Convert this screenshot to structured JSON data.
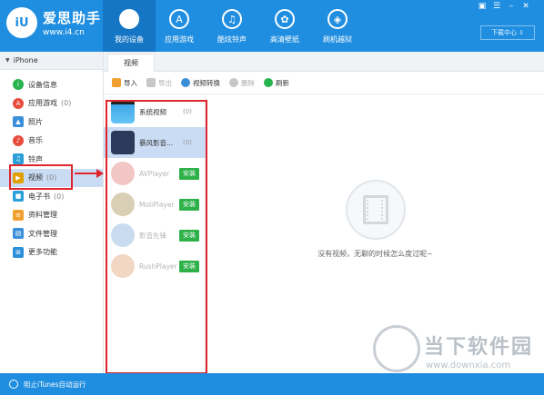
{
  "app": {
    "brand": "爱思助手",
    "url": "www.i4.cn",
    "logo": "iU"
  },
  "nav": [
    {
      "label": "我的设备",
      "icon": "apple-icon",
      "glyph": ""
    },
    {
      "label": "应用游戏",
      "icon": "app-store-icon",
      "glyph": "A"
    },
    {
      "label": "酷炫铃声",
      "icon": "music-note-icon",
      "glyph": "♫"
    },
    {
      "label": "高清壁纸",
      "icon": "flower-icon",
      "glyph": "✿"
    },
    {
      "label": "刷机越狱",
      "icon": "dropbox-icon",
      "glyph": "◈"
    }
  ],
  "window": {
    "download_center": "下载中心 ⇩"
  },
  "sidebar": {
    "device": "iPhone",
    "items": [
      {
        "label": "设备信息",
        "icon": "info-icon",
        "color": "#27b34d",
        "glyph": "i",
        "count": ""
      },
      {
        "label": "应用游戏",
        "icon": "apps-icon",
        "color": "#e74c3c",
        "glyph": "A",
        "count": "(0)"
      },
      {
        "label": "照片",
        "icon": "photo-icon",
        "color": "#3a8fd8",
        "glyph": "▲",
        "count": ""
      },
      {
        "label": "音乐",
        "icon": "music-icon",
        "color": "#e74c3c",
        "glyph": "♪",
        "count": ""
      },
      {
        "label": "铃声",
        "icon": "bell-icon",
        "color": "#2a9fd8",
        "glyph": "♫",
        "count": ""
      },
      {
        "label": "视频",
        "icon": "video-icon",
        "color": "#e0a100",
        "glyph": "▶",
        "count": "(0)"
      },
      {
        "label": "电子书",
        "icon": "ebook-icon",
        "color": "#2a9fd8",
        "glyph": "■",
        "count": "(0)"
      },
      {
        "label": "资料管理",
        "icon": "data-icon",
        "color": "#f0a030",
        "glyph": "≡",
        "count": ""
      },
      {
        "label": "文件管理",
        "icon": "file-icon",
        "color": "#3a8fd8",
        "glyph": "▤",
        "count": ""
      },
      {
        "label": "更多功能",
        "icon": "more-icon",
        "color": "#2a8fd8",
        "glyph": "⊞",
        "count": ""
      }
    ]
  },
  "content": {
    "tab": "视频",
    "toolbar": [
      {
        "label": "导入",
        "icon": "import-icon",
        "color": "#f0a030",
        "disabled": false
      },
      {
        "label": "导出",
        "icon": "export-icon",
        "color": "#c7c7c7",
        "disabled": true
      },
      {
        "label": "视频转换",
        "icon": "convert-icon",
        "color": "#3a8fd8",
        "disabled": false
      },
      {
        "label": "删除",
        "icon": "delete-icon",
        "color": "#c7c7c7",
        "disabled": true
      },
      {
        "label": "刷新",
        "icon": "refresh-icon",
        "color": "#27b34d",
        "disabled": false
      }
    ],
    "apps": [
      {
        "name": "系统视频",
        "count": "(0)",
        "install": "",
        "faded": false,
        "selected": false,
        "color": "#3fa7e8"
      },
      {
        "name": "暴风影音...",
        "count": "(0)",
        "install": "",
        "faded": false,
        "selected": true,
        "color": "#2b3a5a"
      },
      {
        "name": "AVPlayer",
        "count": "",
        "install": "安装",
        "faded": true,
        "selected": false,
        "color": "#f3c6c6"
      },
      {
        "name": "MoliPlayer",
        "count": "",
        "install": "安装",
        "faded": true,
        "selected": false,
        "color": "#d9cfb5"
      },
      {
        "name": "影音先锋",
        "count": "",
        "install": "安装",
        "faded": true,
        "selected": false,
        "color": "#c9dcef"
      },
      {
        "name": "RushPlayer",
        "count": "",
        "install": "安装",
        "faded": true,
        "selected": false,
        "color": "#f2d7c4"
      }
    ],
    "empty_message": "没有视频，无聊的时候怎么度过呢~"
  },
  "footer": {
    "itunes": "阻止iTunes自动运行"
  },
  "watermark": {
    "title": "当下软件园",
    "url": "www.downxia.com"
  },
  "colors": {
    "primary": "#1f8ee0",
    "highlight": "#e0262d",
    "install": "#2fb14a"
  }
}
